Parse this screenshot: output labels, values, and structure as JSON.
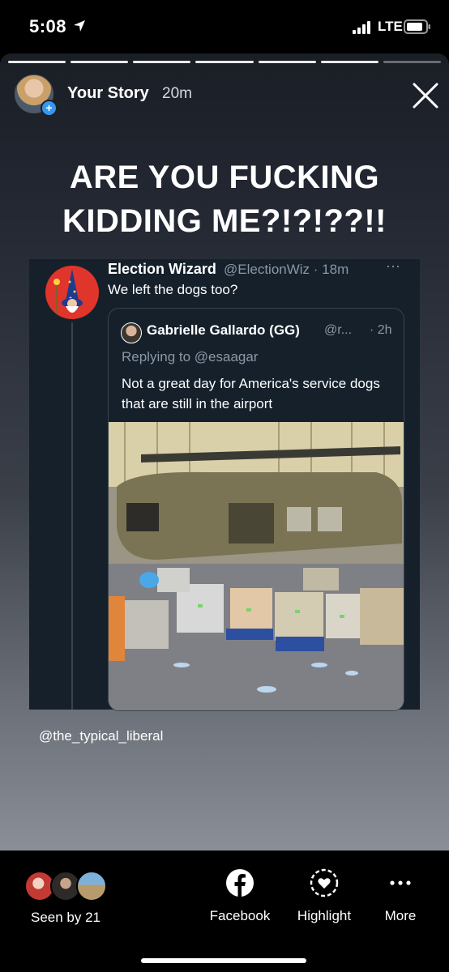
{
  "status_bar": {
    "time": "5:08",
    "network": "LTE"
  },
  "story": {
    "progress_total_segments": 7,
    "progress_completed_segments": 6,
    "user": "Your Story",
    "time": "20m",
    "caption_line1": "ARE YOU FUCKING",
    "caption_line2": "KIDDING ME?!?!??!!",
    "mention": "@the_typical_liberal"
  },
  "tweet": {
    "name": "Election Wizard",
    "handle": "@ElectionWiz · 18m",
    "text": "We left the dogs too?",
    "more": "···",
    "quoted": {
      "name": "Gabrielle Gallardo (GG)",
      "handle": "@r...",
      "time": "· 2h",
      "replying_to": "Replying to @esaagar",
      "text": "Not a great day for America's service dogs that are still in the airport"
    }
  },
  "bottom_bar": {
    "seen_by": "Seen by 21",
    "actions": [
      {
        "label": "Facebook",
        "icon": "facebook-icon"
      },
      {
        "label": "Highlight",
        "icon": "highlight-heart-icon"
      },
      {
        "label": "More",
        "icon": "more-dots-icon"
      }
    ]
  }
}
